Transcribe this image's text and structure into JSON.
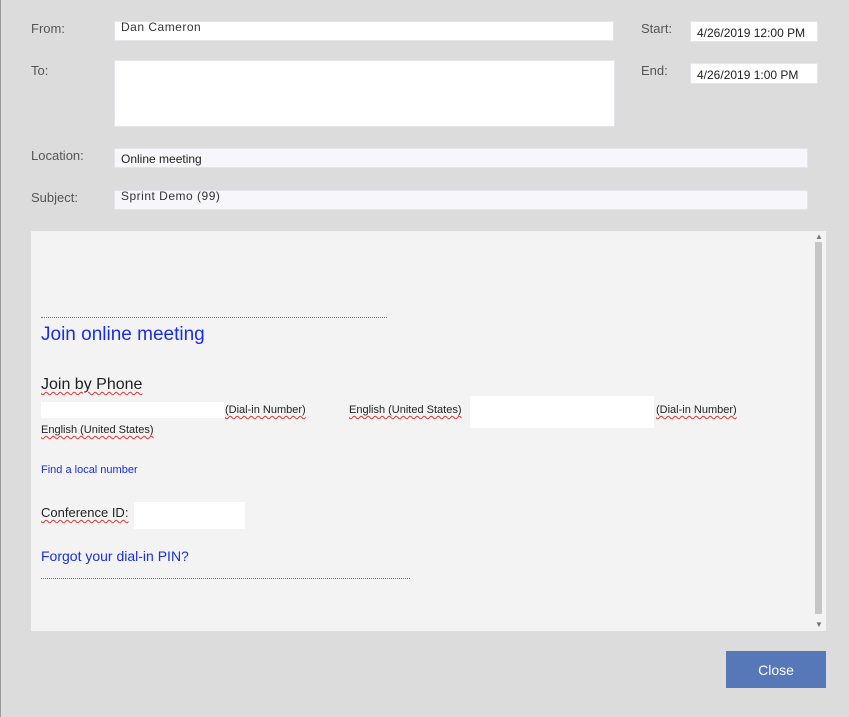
{
  "fields": {
    "from_label": "From:",
    "from_value": "Dan Cameron",
    "to_label": "To:",
    "to_value": "",
    "start_label": "Start:",
    "start_value": "4/26/2019 12:00 PM",
    "end_label": "End:",
    "end_value": "4/26/2019 1:00 PM",
    "location_label": "Location:",
    "location_value": "Online meeting",
    "subject_label": "Subject:",
    "subject_value": "Sprint Demo (99)"
  },
  "body": {
    "join_link": "Join online meeting",
    "join_phone_title": "Join by Phone",
    "dial_in_1": "(Dial-in Number)",
    "lang_1": "English (United States)",
    "dial_in_2": "(Dial-in Number)",
    "lang_2": "English (United States)",
    "find_local": "Find a local number",
    "conference_label": "Conference ID:",
    "forgot_pin": "Forgot your dial-in PIN?"
  },
  "buttons": {
    "close": "Close"
  }
}
